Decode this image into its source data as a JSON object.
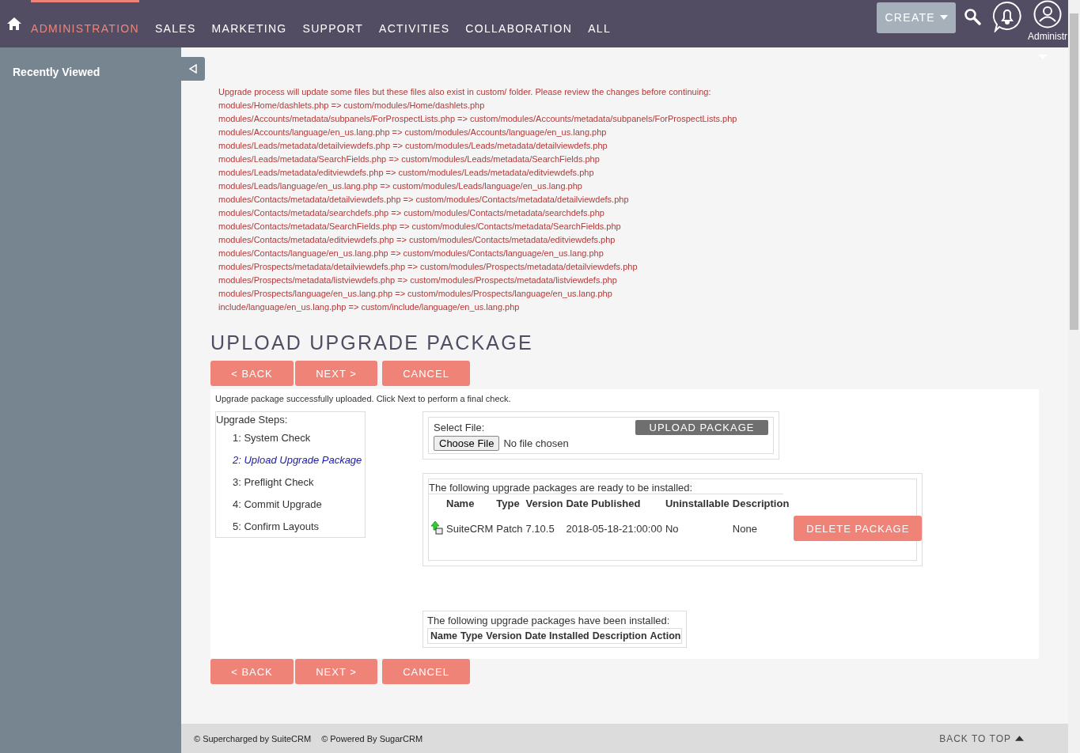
{
  "nav": {
    "items": [
      {
        "label": "ADMINISTRATION",
        "selected": true
      },
      {
        "label": "SALES",
        "selected": false
      },
      {
        "label": "MARKETING",
        "selected": false
      },
      {
        "label": "SUPPORT",
        "selected": false
      },
      {
        "label": "ACTIVITIES",
        "selected": false
      },
      {
        "label": "COLLABORATION",
        "selected": false
      },
      {
        "label": "ALL",
        "selected": false
      }
    ],
    "create_button": "CREATE",
    "user_name": "Administr"
  },
  "sidebar": {
    "title": "Recently Viewed"
  },
  "warning": {
    "intro": "Upgrade process will update some files but these files also exist in custom/ folder. Please review the changes before continuing:",
    "files": [
      "modules/Home/dashlets.php => custom/modules/Home/dashlets.php",
      "modules/Accounts/metadata/subpanels/ForProspectLists.php => custom/modules/Accounts/metadata/subpanels/ForProspectLists.php",
      "modules/Accounts/language/en_us.lang.php => custom/modules/Accounts/language/en_us.lang.php",
      "modules/Leads/metadata/detailviewdefs.php => custom/modules/Leads/metadata/detailviewdefs.php",
      "modules/Leads/metadata/SearchFields.php => custom/modules/Leads/metadata/SearchFields.php",
      "modules/Leads/metadata/editviewdefs.php => custom/modules/Leads/metadata/editviewdefs.php",
      "modules/Leads/language/en_us.lang.php => custom/modules/Leads/language/en_us.lang.php",
      "modules/Contacts/metadata/detailviewdefs.php => custom/modules/Contacts/metadata/detailviewdefs.php",
      "modules/Contacts/metadata/searchdefs.php => custom/modules/Contacts/metadata/searchdefs.php",
      "modules/Contacts/metadata/SearchFields.php => custom/modules/Contacts/metadata/SearchFields.php",
      "modules/Contacts/metadata/editviewdefs.php => custom/modules/Contacts/metadata/editviewdefs.php",
      "modules/Contacts/language/en_us.lang.php => custom/modules/Contacts/language/en_us.lang.php",
      "modules/Prospects/metadata/detailviewdefs.php => custom/modules/Prospects/metadata/detailviewdefs.php",
      "modules/Prospects/metadata/listviewdefs.php => custom/modules/Prospects/metadata/listviewdefs.php",
      "modules/Prospects/language/en_us.lang.php => custom/modules/Prospects/language/en_us.lang.php",
      "include/language/en_us.lang.php => custom/include/language/en_us.lang.php"
    ]
  },
  "page_title": "UPLOAD UPGRADE PACKAGE",
  "top_buttons": [
    "< BACK",
    "NEXT >",
    "CANCEL"
  ],
  "message": "Upgrade package successfully uploaded. Click Next to perform a final check.",
  "steps": {
    "title": "Upgrade Steps:",
    "items": [
      {
        "label": "1: System Check",
        "selected": false
      },
      {
        "label": "2: Upload Upgrade Package",
        "selected": true
      },
      {
        "label": "3: Preflight Check",
        "selected": false
      },
      {
        "label": "4: Commit Upgrade",
        "selected": false
      },
      {
        "label": "5: Confirm Layouts",
        "selected": false
      }
    ]
  },
  "upload": {
    "label": "Select File:",
    "choose_button": "Choose File",
    "file_status": "No file chosen",
    "upload_button": "UPLOAD PACKAGE"
  },
  "ready": {
    "heading": "The following upgrade packages are ready to be installed:",
    "columns": [
      "Name",
      "Type",
      "Version",
      "Date Published",
      "Uninstallable",
      "Description"
    ],
    "rows": [
      {
        "cells": [
          "SuiteCRM",
          "Patch",
          "7.10.5",
          "2018-05-18-21:00:00",
          "No",
          "None"
        ],
        "delete_button": "DELETE PACKAGE"
      }
    ]
  },
  "installed": {
    "heading": "The following upgrade packages have been installed:",
    "columns": [
      "Name",
      "Type",
      "Version",
      "Date Installed",
      "Description",
      "Action"
    ]
  },
  "bottom_buttons": [
    "< BACK",
    "NEXT >",
    "CANCEL"
  ],
  "footer": {
    "credits": [
      "© Supercharged by SuiteCRM",
      "© Powered By SugarCRM"
    ],
    "back_to_top": "BACK TO TOP"
  }
}
